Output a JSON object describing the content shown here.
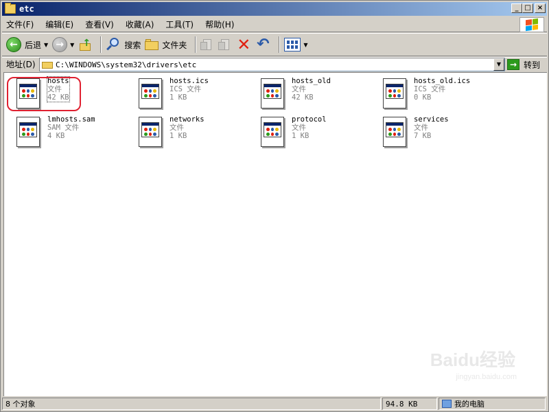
{
  "window": {
    "title": "etc",
    "buttons": {
      "minimize": "_",
      "maximize": "□",
      "close": "×"
    }
  },
  "menu": [
    "文件(F)",
    "编辑(E)",
    "查看(V)",
    "收藏(A)",
    "工具(T)",
    "帮助(H)"
  ],
  "toolbar": {
    "back_label": "后退",
    "search_label": "搜索",
    "folders_label": "文件夹"
  },
  "address": {
    "label": "地址(D)",
    "path": "C:\\WINDOWS\\system32\\drivers\\etc",
    "go_label": "转到"
  },
  "files": [
    {
      "name": "hosts",
      "type": "文件",
      "size": "42 KB",
      "selected": true
    },
    {
      "name": "hosts.ics",
      "type": "ICS 文件",
      "size": "1 KB"
    },
    {
      "name": "hosts_old",
      "type": "文件",
      "size": "42 KB"
    },
    {
      "name": "hosts_old.ics",
      "type": "ICS 文件",
      "size": "0 KB"
    },
    {
      "name": "lmhosts.sam",
      "type": "SAM 文件",
      "size": "4 KB"
    },
    {
      "name": "networks",
      "type": "文件",
      "size": "1 KB"
    },
    {
      "name": "protocol",
      "type": "文件",
      "size": "1 KB"
    },
    {
      "name": "services",
      "type": "文件",
      "size": "7 KB"
    }
  ],
  "status": {
    "count": "8 个对象",
    "size": "94.8 KB",
    "location": "我的电脑"
  },
  "watermark": {
    "brand": "Baidu经验",
    "url": "jingyan.baidu.com"
  },
  "colors": {
    "titlebar_start": "#0a246a",
    "titlebar_end": "#a6caf0",
    "highlight_ring": "#e02030",
    "window_bg": "#d4d0c8"
  }
}
